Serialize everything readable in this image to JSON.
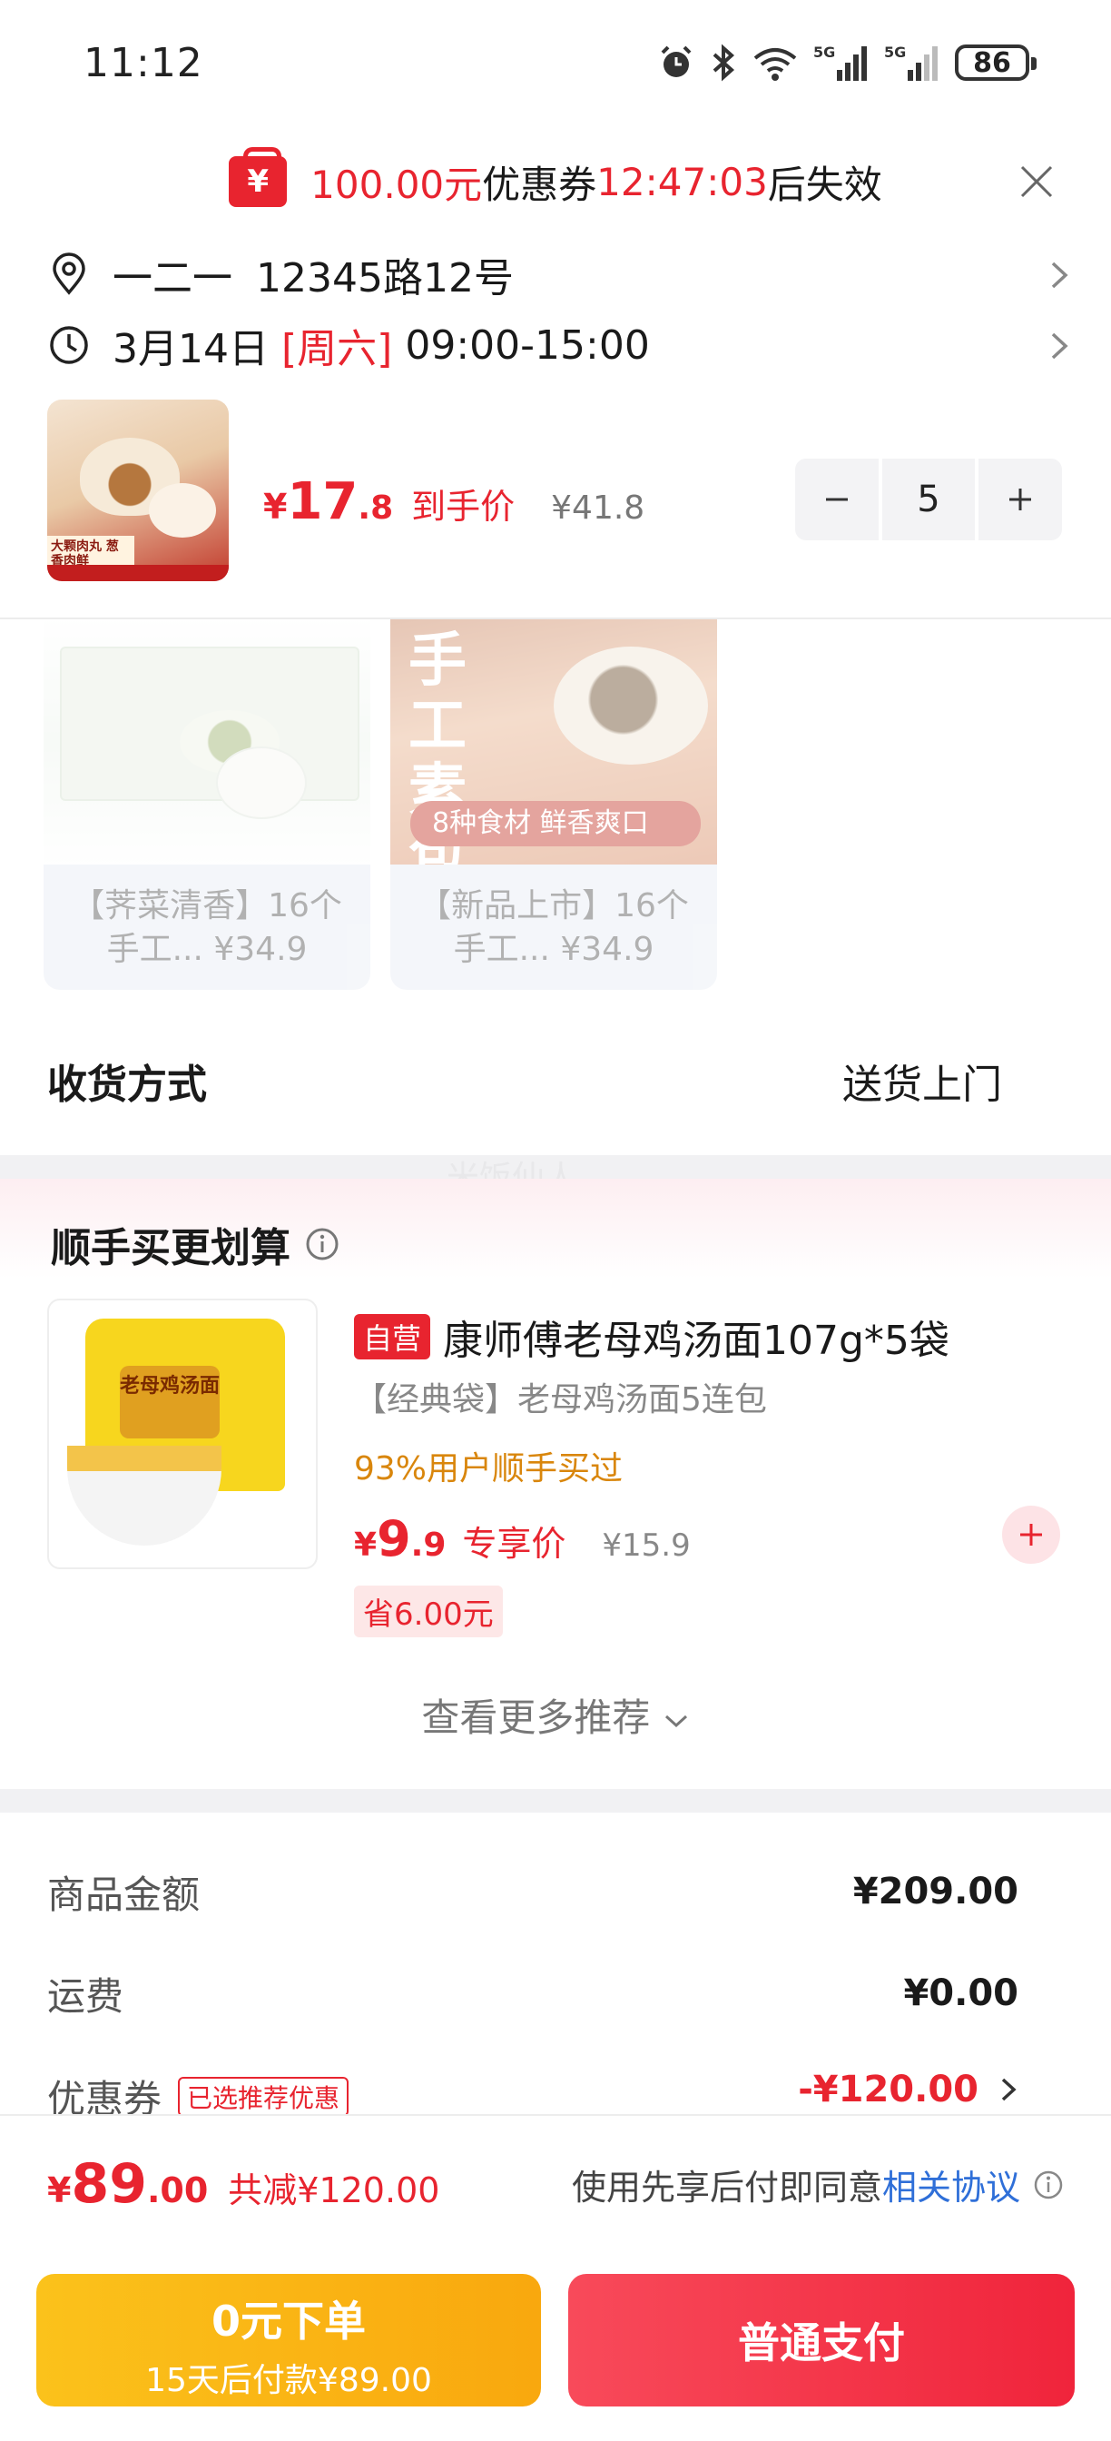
{
  "status_bar": {
    "time": "11:12",
    "net1": "5G",
    "net2": "5G",
    "battery": "86"
  },
  "coupon_banner": {
    "icon_text": "¥",
    "amount": "100.00元",
    "middle": "优惠券",
    "countdown": "12:47:03",
    "tail": "后失效"
  },
  "address": {
    "name": "一二一",
    "street": "12345路12号"
  },
  "delivery_time": {
    "date": "3月14日",
    "weekday": "[周六]",
    "window": "09:00-15:00"
  },
  "product": {
    "price_symbol": "¥",
    "price_int": "17",
    "price_dec": ".8",
    "price_label": "到手价",
    "original_price": "¥41.8",
    "quantity": "5",
    "thumb_text": "大颗肉丸 葱香肉鲜"
  },
  "recommendations": [
    {
      "caption_line1": "【荠菜清香】16个",
      "caption_line2": "手工... ¥34.9"
    },
    {
      "caption_line1": "【新品上市】16个",
      "caption_line2": "手工... ¥34.9",
      "art_title": "手工 素包",
      "ribbon": "8种食材 鲜香爽口"
    }
  ],
  "shipping": {
    "label": "收货方式",
    "value": "送货上门"
  },
  "watermark": "米饭仙人",
  "upsell": {
    "title": "顺手买更划算",
    "item": {
      "tag": "自营",
      "name": "康师傅老母鸡汤面107g*5袋",
      "subtitle": "【经典袋】老母鸡汤面5连包",
      "bought": "93%用户顺手买过",
      "price_symbol": "¥",
      "price_int": "9",
      "price_dec": ".9",
      "price_label": "专享价",
      "original_price": "¥15.9",
      "saving": "省6.00元",
      "thumb_text": "老母鸡汤面"
    },
    "more": "查看更多推荐"
  },
  "amounts": {
    "goods_label": "商品金额",
    "goods_value": "¥209.00",
    "freight_label": "运费",
    "freight_value": "¥0.00",
    "coupon_label": "优惠券",
    "coupon_badge": "已选推荐优惠",
    "coupon_value": "-¥120.00"
  },
  "footer": {
    "total_symbol": "¥",
    "total_int": "89",
    "total_dec": ".00",
    "reduced": "共减¥120.00",
    "agree_text": "使用先享后付即同意",
    "agree_link": "相关协议",
    "btn_zero_main": "0元下单",
    "btn_zero_sub": "15天后付款¥89.00",
    "btn_pay": "普通支付"
  },
  "colors": {
    "accent_red": "#e8242f",
    "pay_yellow": "#fbc21b",
    "link_blue": "#2f6fd8",
    "bought_orange": "#d9860c"
  }
}
